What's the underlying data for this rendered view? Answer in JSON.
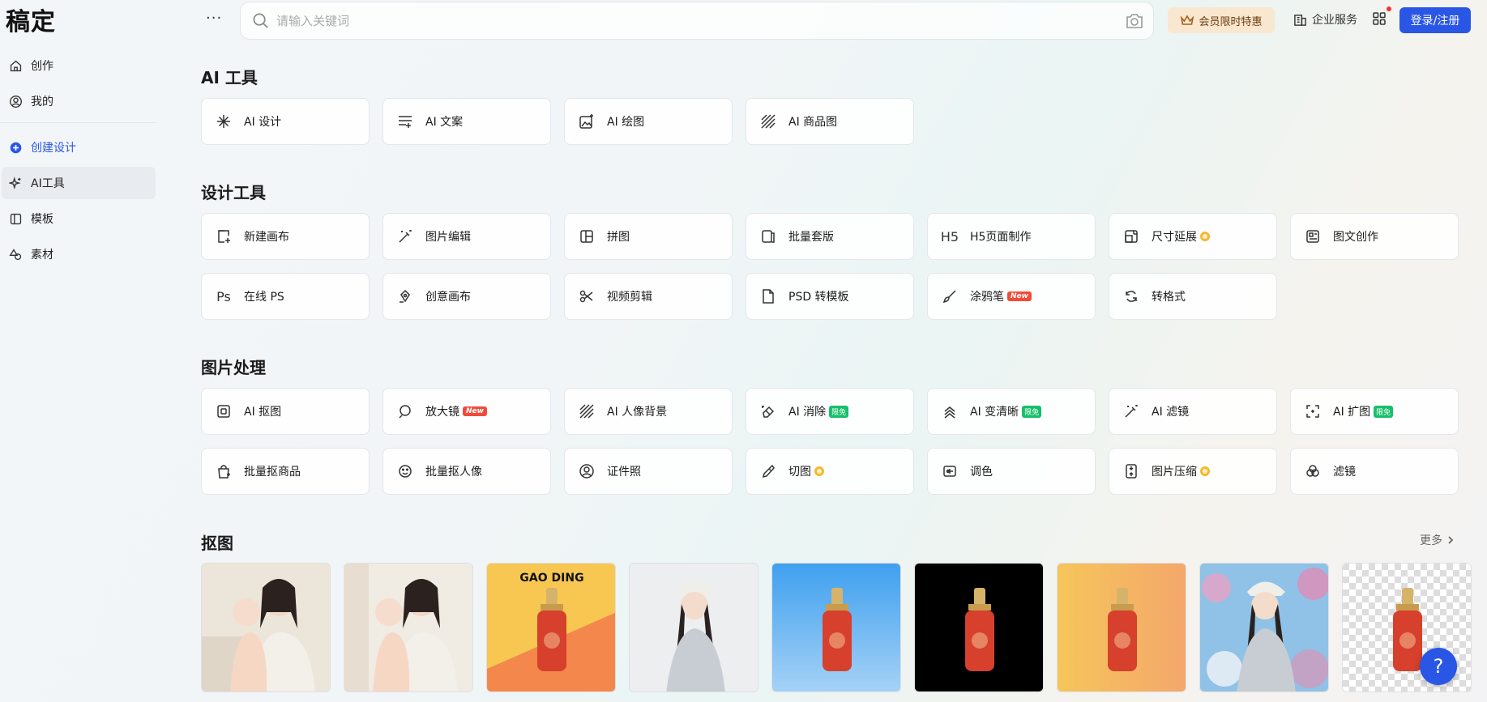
{
  "app": {
    "logo": "稿定"
  },
  "sidebar": {
    "items": [
      {
        "label": "创作",
        "icon": "home-icon"
      },
      {
        "label": "我的",
        "icon": "user-icon"
      },
      {
        "label": "创建设计",
        "icon": "plus-circle-icon"
      },
      {
        "label": "AI工具",
        "icon": "sparkle-icon"
      },
      {
        "label": "模板",
        "icon": "template-icon"
      },
      {
        "label": "素材",
        "icon": "shapes-icon"
      }
    ],
    "active": "AI工具"
  },
  "header": {
    "more": "···",
    "search_placeholder": "请输入关键词",
    "vip_label": "会员限时特惠",
    "enterprise_label": "企业服务",
    "login_label": "登录/注册"
  },
  "sections": {
    "ai_tools": {
      "title": "AI 工具",
      "items": [
        {
          "label": "AI 设计",
          "icon": "sparkle-icon"
        },
        {
          "label": "AI 文案",
          "icon": "text-lines-icon"
        },
        {
          "label": "AI 绘图",
          "icon": "image-sparkle-icon"
        },
        {
          "label": "AI 商品图",
          "icon": "hatch-icon"
        }
      ]
    },
    "design_tools": {
      "title": "设计工具",
      "items": [
        {
          "label": "新建画布",
          "icon": "new-canvas-icon"
        },
        {
          "label": "图片编辑",
          "icon": "magic-wand-icon"
        },
        {
          "label": "拼图",
          "icon": "collage-icon"
        },
        {
          "label": "批量套版",
          "icon": "batch-icon"
        },
        {
          "label": "H5页面制作",
          "icon": "h5-icon"
        },
        {
          "label": "尺寸延展",
          "icon": "resize-icon",
          "badge": "vip"
        },
        {
          "label": "图文创作",
          "icon": "article-icon"
        },
        {
          "label": "在线 PS",
          "icon": "ps-icon"
        },
        {
          "label": "创意画布",
          "icon": "pen-nib-icon"
        },
        {
          "label": "视频剪辑",
          "icon": "scissors-icon"
        },
        {
          "label": "PSD 转模板",
          "icon": "file-icon"
        },
        {
          "label": "涂鸦笔",
          "icon": "brush-icon",
          "badge": "New"
        },
        {
          "label": "转格式",
          "icon": "convert-icon"
        }
      ]
    },
    "image_processing": {
      "title": "图片处理",
      "items": [
        {
          "label": "AI 抠图",
          "icon": "cutout-icon"
        },
        {
          "label": "放大镜",
          "icon": "magnifier-icon",
          "badge": "New"
        },
        {
          "label": "AI 人像背景",
          "icon": "hatch-icon"
        },
        {
          "label": "AI 消除",
          "icon": "eraser-icon",
          "badge": "限免"
        },
        {
          "label": "AI 变清晰",
          "icon": "sharpen-icon",
          "badge": "限免"
        },
        {
          "label": "AI 滤镜",
          "icon": "magic-wand-icon"
        },
        {
          "label": "AI 扩图",
          "icon": "expand-icon",
          "badge": "限免"
        },
        {
          "label": "批量抠商品",
          "icon": "shopping-bag-icon"
        },
        {
          "label": "批量抠人像",
          "icon": "face-icon"
        },
        {
          "label": "证件照",
          "icon": "id-photo-icon"
        },
        {
          "label": "切图",
          "icon": "knife-icon",
          "badge": "vip"
        },
        {
          "label": "调色",
          "icon": "adjust-icon"
        },
        {
          "label": "图片压缩",
          "icon": "compress-icon",
          "badge": "vip"
        },
        {
          "label": "滤镜",
          "icon": "filter-icon"
        }
      ]
    },
    "cutout": {
      "title": "抠图",
      "more_label": "更多",
      "thumb_text": "GAO DING"
    }
  },
  "help_label": "?",
  "colors": {
    "accent": "#2a56e6",
    "vip_bg": "#fae7cf",
    "new_badge": "#f04b3a",
    "free_badge": "#16c06a"
  }
}
